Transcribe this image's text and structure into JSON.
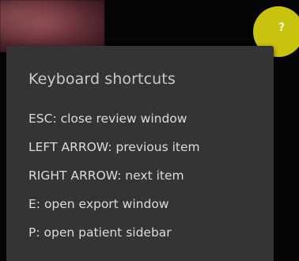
{
  "help_button": {
    "glyph": "?",
    "color": "#c9c20f"
  },
  "tooltip": {
    "title": "Keyboard shortcuts",
    "shortcuts": [
      "ESC: close review window",
      "LEFT ARROW: previous item",
      "RIGHT ARROW: next item",
      "E: open export window",
      "P: open patient sidebar"
    ],
    "background": "#343434"
  }
}
